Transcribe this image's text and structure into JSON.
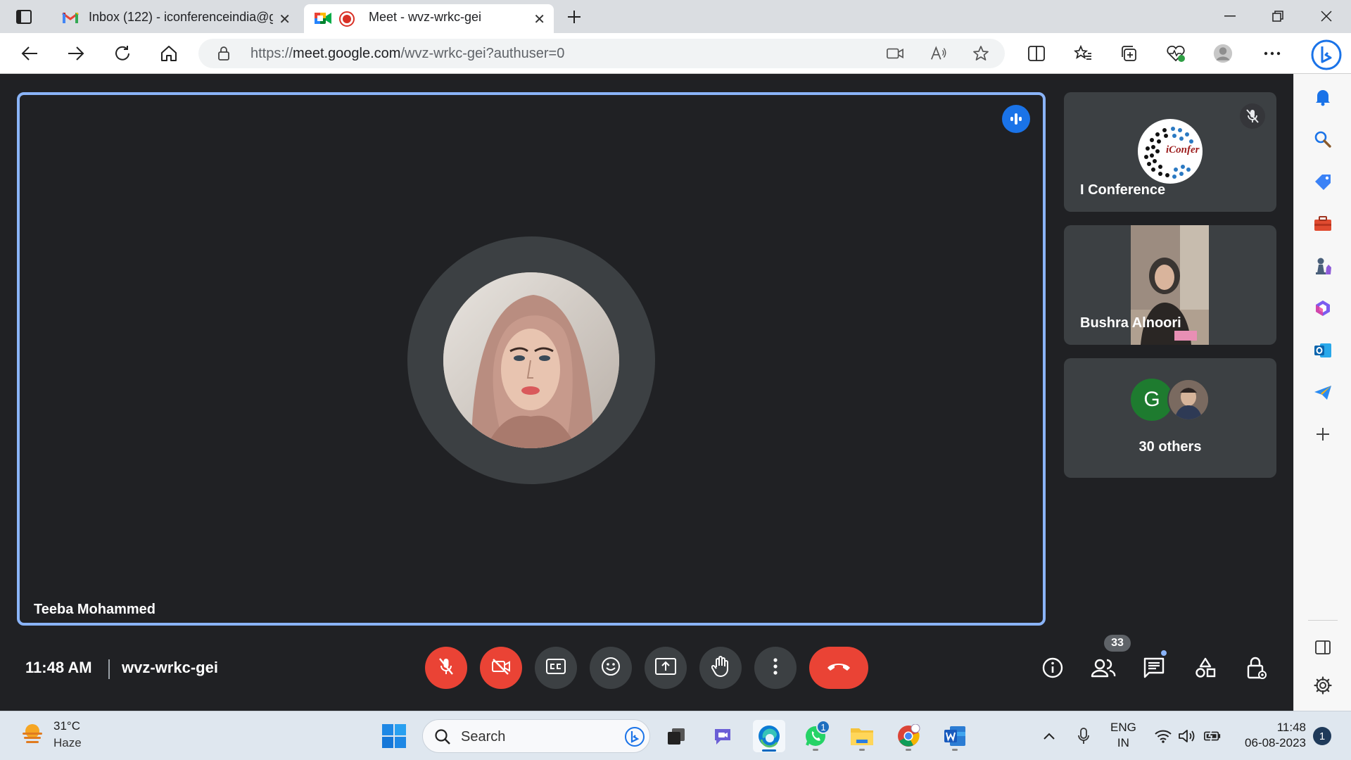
{
  "browser": {
    "tabs": [
      {
        "title": "Inbox (122) - iconferenceindia@g",
        "icon": "gmail-icon"
      },
      {
        "title": "Meet - wvz-wrkc-gei",
        "icon": "google-meet-icon",
        "recording": true
      }
    ],
    "url": {
      "scheme": "https://",
      "host": "meet.google.com",
      "path": "/wvz-wrkc-gei?authuser=0"
    }
  },
  "meet": {
    "main_speaker": {
      "name": "Teeba Mohammed"
    },
    "participants": [
      {
        "name": "I Conference",
        "muted": true,
        "logo_text": "iConfer"
      },
      {
        "name": "Bushra Alnoori"
      }
    ],
    "others": {
      "label": "30 others",
      "avatar_letter": "G"
    },
    "clock": "11:48 AM",
    "meeting_code": "wvz-wrkc-gei",
    "people_count": "33"
  },
  "taskbar": {
    "weather": {
      "temp": "31°C",
      "desc": "Haze"
    },
    "search_placeholder": "Search",
    "whatsapp_badge": "1",
    "lang_line1": "ENG",
    "lang_line2": "IN",
    "time": "11:48",
    "date": "06-08-2023",
    "notifications": "1"
  },
  "colors": {
    "meet_bg": "#202124",
    "tile_bg": "#3c4043",
    "accent_blue": "#8ab4f8",
    "danger_red": "#ea4335",
    "speaking_blue": "#1a73e8"
  }
}
